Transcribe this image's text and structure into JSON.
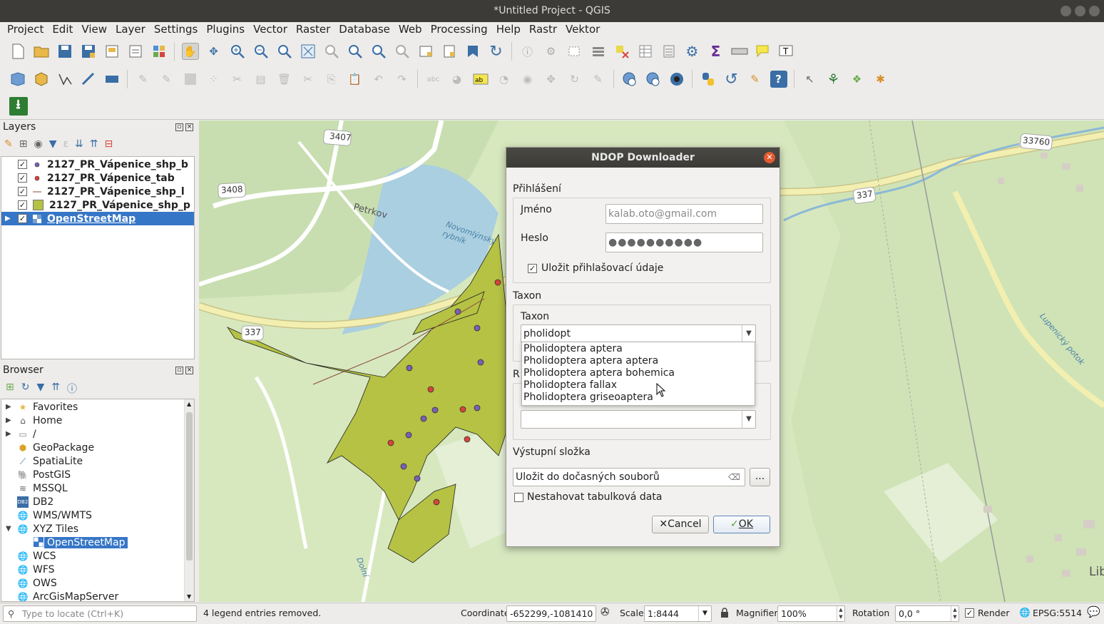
{
  "window": {
    "title": "*Untitled Project - QGIS"
  },
  "menu": [
    "Project",
    "Edit",
    "View",
    "Layer",
    "Settings",
    "Plugins",
    "Vector",
    "Raster",
    "Database",
    "Web",
    "Processing",
    "Help",
    "Rastr",
    "Vektor"
  ],
  "layers_panel": {
    "title": "Layers",
    "layers": [
      {
        "name": "2127_PR_Vápenice_shp_b",
        "checked": "✓",
        "symbol": "point-purple"
      },
      {
        "name": "2127_PR_Vápenice_tab",
        "checked": "✓",
        "symbol": "point-red"
      },
      {
        "name": "2127_PR_Vápenice_shp_l",
        "checked": "✓",
        "symbol": "line"
      },
      {
        "name": "2127_PR_Vápenice_shp_p",
        "checked": "✓",
        "symbol": "polygon-green"
      },
      {
        "name": "OpenStreetMap",
        "checked": "✓",
        "symbol": "xyz-tiles"
      }
    ]
  },
  "browser_panel": {
    "title": "Browser",
    "items": [
      {
        "label": "Favorites",
        "icon": "star-icon"
      },
      {
        "label": "Home",
        "icon": "home-icon"
      },
      {
        "label": "/",
        "icon": "folder-icon"
      },
      {
        "label": "GeoPackage",
        "icon": "geopackage-icon"
      },
      {
        "label": "SpatiaLite",
        "icon": "spatialite-icon"
      },
      {
        "label": "PostGIS",
        "icon": "postgis-icon"
      },
      {
        "label": "MSSQL",
        "icon": "mssql-icon"
      },
      {
        "label": "DB2",
        "icon": "db2-icon"
      },
      {
        "label": "WMS/WMTS",
        "icon": "globe-icon"
      },
      {
        "label": "XYZ Tiles",
        "icon": "globe-icon"
      },
      {
        "label": "OpenStreetMap",
        "icon": "xyz-tiles-icon"
      },
      {
        "label": "WCS",
        "icon": "globe-icon"
      },
      {
        "label": "WFS",
        "icon": "globe-icon"
      },
      {
        "label": "OWS",
        "icon": "globe-icon"
      },
      {
        "label": "ArcGisMapServer",
        "icon": "globe-icon"
      }
    ]
  },
  "map": {
    "labels": [
      "3407",
      "3408",
      "Petrkov",
      "Novomlýnský rybník",
      "337",
      "33760",
      "337",
      "Dolní",
      "Lupenický potok",
      "Lib"
    ]
  },
  "dialog": {
    "title": "NDOP Downloader",
    "login_group": "Přihlášení",
    "name_label": "Jméno",
    "name_placeholder": "kalab.oto@gmail.com",
    "password_label": "Heslo",
    "password_value": "●●●●●●●●●●",
    "save_credentials_label": "Uložit přihlašovací údaje",
    "save_credentials_checked": "✓",
    "taxon_group": "Taxon",
    "taxon_label": "Taxon",
    "taxon_value": "pholidopt",
    "taxon_suggestions": [
      "Pholidoptera aptera",
      "Pholidoptera aptera aptera",
      "Pholidoptera aptera bohemica",
      "Pholidoptera fallax",
      "Pholidoptera griseoaptera"
    ],
    "region_group_initial": "R",
    "region_value": "",
    "output_group": "Výstupní složka",
    "output_value": "Uložit do dočasných souborů",
    "browse_button": "...",
    "no_table_label": "Nestahovat tabulková data",
    "cancel_button": "Cancel",
    "ok_button": "OK"
  },
  "statusbar": {
    "locator_placeholder": "Type to locate (Ctrl+K)",
    "message": "4 legend entries removed.",
    "coordinate_label": "Coordinate",
    "coordinate_value": "-652299,-1081410",
    "scale_label": "Scale",
    "scale_value": "1:8444",
    "magnifier_label": "Magnifier",
    "magnifier_value": "100%",
    "rotation_label": "Rotation",
    "rotation_value": "0,0 °",
    "render_label": "Render",
    "crs": "EPSG:5514"
  },
  "colors": {
    "accent": "#3676c7",
    "polygon": "#b5c244",
    "point_purple": "#7a5fb5",
    "point_red": "#d9443a",
    "titlebar": "#3c3b37"
  }
}
